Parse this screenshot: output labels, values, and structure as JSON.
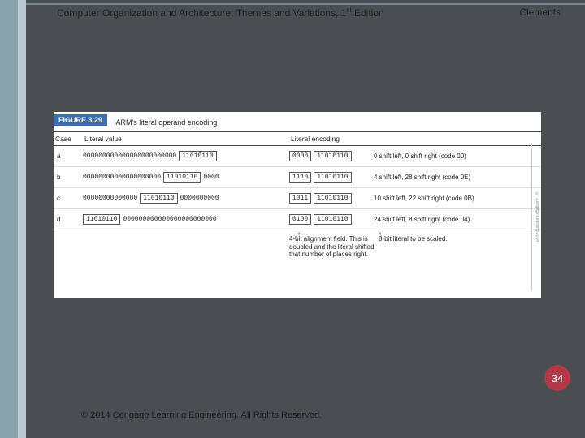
{
  "header": {
    "title_pre": "Computer Organization and Architecture: Themes and Variations, 1",
    "title_sup": "st",
    "title_post": " Edition",
    "author": "Clements"
  },
  "figure": {
    "label": "FIGURE 3.29",
    "title": "ARM's literal operand encoding",
    "columns": {
      "c1": "Case",
      "c2": "Literal value",
      "c3": "Literal encoding",
      "c4": ""
    },
    "rows": [
      {
        "case": "a",
        "zeros_left": "000000000000000000000000",
        "byte": "11010110",
        "zeros_right": "",
        "enc_align": "0000",
        "enc_lit": "11010110",
        "desc": "0 shift left, 0 shift right (code 00)"
      },
      {
        "case": "b",
        "zeros_left": "00000000000000000000",
        "byte": "11010110",
        "zeros_right": "0000",
        "enc_align": "1110",
        "enc_lit": "11010110",
        "desc": "4 shift left, 28 shift right (code 0E)"
      },
      {
        "case": "c",
        "zeros_left": "00000000000000",
        "byte": "11010110",
        "zeros_right": "0000000000",
        "enc_align": "1011",
        "enc_lit": "11010110",
        "desc": "10 shift left, 22 shift right (code 0B)"
      },
      {
        "case": "d",
        "zeros_left": "",
        "byte": "11010110",
        "zeros_right": "000000000000000000000000",
        "enc_align": "0100",
        "enc_lit": "11010110",
        "desc": "24 shift left, 8 shift right (code 04)"
      }
    ],
    "callout_align": "4-bit alignment field. This is doubled and the literal shifted that number of places right.",
    "callout_lit": "8-bit literal to be scaled.",
    "sidecap": "© Cengage Learning 2014"
  },
  "page_number": "34",
  "footer": "© 2014 Cengage Learning Engineering. All Rights Reserved."
}
